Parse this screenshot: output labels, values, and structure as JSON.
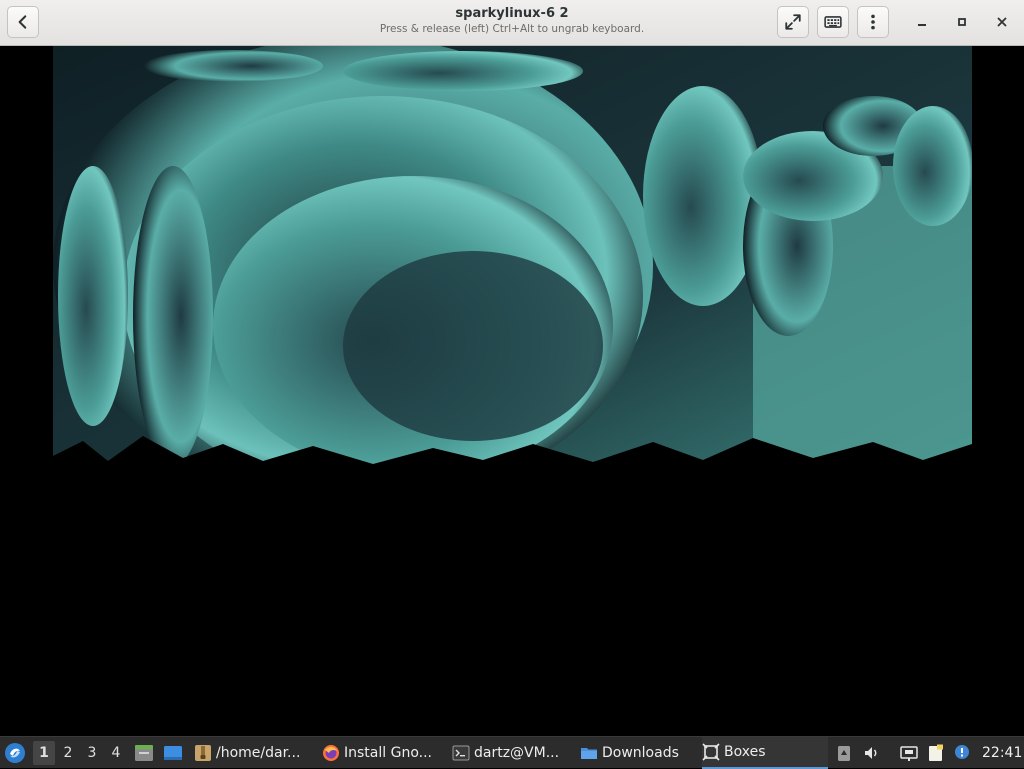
{
  "window": {
    "title": "sparkylinux-6 2",
    "subtitle": "Press & release (left) Ctrl+Alt to ungrab keyboard."
  },
  "headerbar_buttons": {
    "back": "back-arrow-icon",
    "fullscreen": "fullscreen-icon",
    "keyboard": "keyboard-icon",
    "menu": "vertical-dots-menu-icon",
    "minimize": "minimize-icon",
    "maximize": "maximize-icon",
    "close": "close-icon"
  },
  "guest_display": {
    "wallpaper": "teal fractal",
    "colors": {
      "teal": "#5fb3ad",
      "dark": "#0b1a1f"
    }
  },
  "taskbar": {
    "start_icon": "sparky-start-icon",
    "workspaces": [
      "1",
      "2",
      "3",
      "4"
    ],
    "active_workspace": "1",
    "launchers": [
      "file-manager-icon",
      "desktop-icon"
    ],
    "tasks": [
      {
        "label": "/home/dar...",
        "icon": "archive-icon"
      },
      {
        "label": "Install Gno...",
        "icon": "firefox-icon"
      },
      {
        "label": "dartz@VM...",
        "icon": "terminal-icon"
      },
      {
        "label": "Downloads",
        "icon": "folder-icon"
      },
      {
        "label": "Boxes",
        "icon": "boxes-icon",
        "active": true
      }
    ],
    "tray": [
      "clipboard-icon",
      "volume-icon",
      "network-icon",
      "notes-icon",
      "updates-icon"
    ],
    "clock": "22:41"
  }
}
